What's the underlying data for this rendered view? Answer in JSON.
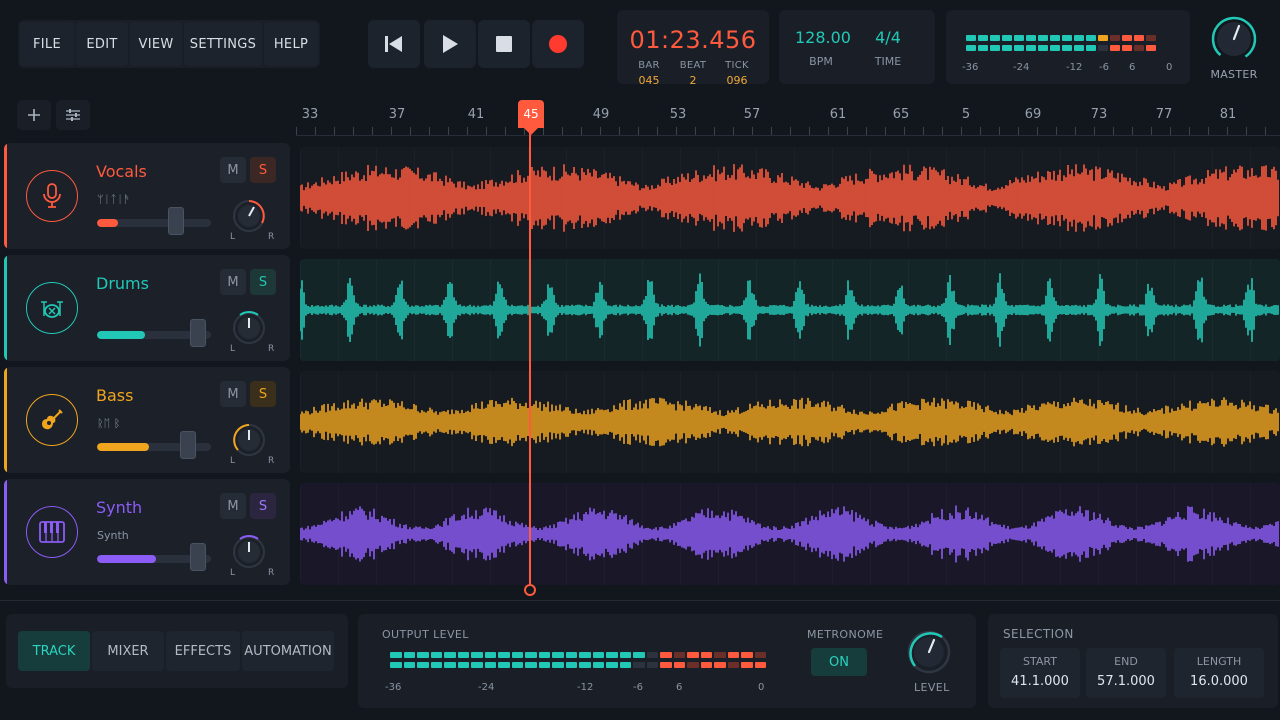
{
  "menu": {
    "items": [
      "FILE",
      "EDIT",
      "VIEW",
      "SETTINGS",
      "HELP"
    ]
  },
  "transport": {
    "buttons": [
      "skip-back",
      "play",
      "stop",
      "record"
    ]
  },
  "position": {
    "time": "01:23.456",
    "bar_label": "BAR",
    "bar": "045",
    "beat_label": "BEAT",
    "beat": "2",
    "tick_label": "TICK",
    "tick": "096"
  },
  "tempo": {
    "bpm": "128.00",
    "bpm_label": "BPM",
    "time_sig": "4/4",
    "time_label": "TIME"
  },
  "master_meter": {
    "scale": [
      "-36",
      "-24",
      "-12",
      "-6",
      "6",
      "0"
    ],
    "level_fraction": 0.74
  },
  "master": {
    "label": "MASTER"
  },
  "ruler": {
    "bars": [
      "33",
      "37",
      "41",
      "45",
      "49",
      "53",
      "57",
      "61",
      "65",
      "5",
      "69",
      "73",
      "77",
      "81"
    ],
    "playhead_bar": "45"
  },
  "tracks": [
    {
      "name": "Vocals",
      "sub": "ᛘᛁᛏᛁᚫ",
      "color": "#ff5a3d",
      "mute": "M",
      "solo": "S",
      "volume": 0.18,
      "pan": 0.3,
      "pan_left": "L",
      "pan_right": "R",
      "solo_active": false
    },
    {
      "name": "Drums",
      "sub": "",
      "color": "#22c8b6",
      "mute": "M",
      "solo": "S",
      "volume": 0.42,
      "pan": 0.0,
      "pan_left": "L",
      "pan_right": "R",
      "solo_active": true
    },
    {
      "name": "Bass",
      "sub": "ᚱᛖ ᛒ",
      "color": "#f0a51e",
      "mute": "M",
      "solo": "S",
      "volume": 0.46,
      "pan": 0.0,
      "pan_left": "L",
      "pan_right": "R",
      "solo_active": true
    },
    {
      "name": "Synth",
      "sub": "Synth",
      "color": "#8b5cf6",
      "mute": "M",
      "solo": "S",
      "volume": 0.52,
      "pan": 0.0,
      "pan_left": "L",
      "pan_right": "R",
      "solo_active": true
    }
  ],
  "bottom_tabs": {
    "items": [
      "TRACK",
      "MIXER",
      "EFFECTS",
      "AUTOMATION"
    ],
    "active": "TRACK"
  },
  "output": {
    "label": "OUTPUT LEVEL",
    "scale": [
      "-36",
      "-24",
      "-12",
      "-6",
      "6",
      "0"
    ],
    "level_fraction": 0.68,
    "metronome_label": "METRONOME",
    "metronome_state": "ON",
    "level_label": "LEVEL"
  },
  "selection": {
    "label": "SELECTION",
    "start_label": "START",
    "start": "41.1.000",
    "end_label": "END",
    "end": "57.1.000",
    "length_label": "LENGTH",
    "length": "16.0.000"
  }
}
